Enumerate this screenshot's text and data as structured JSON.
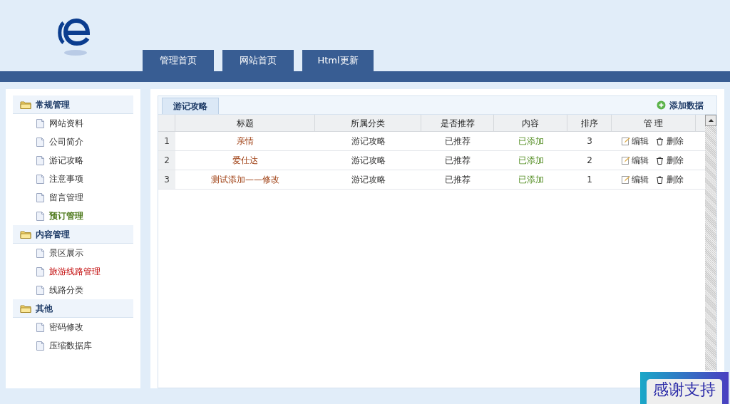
{
  "nav_tabs": [
    {
      "label": "管理首页"
    },
    {
      "label": "网站首页"
    },
    {
      "label": "Html更新"
    }
  ],
  "sidebar": {
    "groups": [
      {
        "title": "常规管理",
        "items": [
          {
            "label": "网站资料",
            "kind": "normal"
          },
          {
            "label": "公司简介",
            "kind": "normal"
          },
          {
            "label": "游记攻略",
            "kind": "normal"
          },
          {
            "label": "注意事项",
            "kind": "normal"
          },
          {
            "label": "留言管理",
            "kind": "normal"
          },
          {
            "label": "预订管理",
            "kind": "current"
          }
        ]
      },
      {
        "title": "内容管理",
        "items": [
          {
            "label": "景区展示",
            "kind": "normal"
          },
          {
            "label": "旅游线路管理",
            "kind": "highlighted"
          },
          {
            "label": "线路分类",
            "kind": "normal"
          }
        ]
      },
      {
        "title": "其他",
        "items": [
          {
            "label": "密码修改",
            "kind": "normal"
          },
          {
            "label": "压缩数据库",
            "kind": "normal"
          }
        ]
      }
    ]
  },
  "panel": {
    "tab": "游记攻略",
    "add_button": "添加数据",
    "table": {
      "columns": [
        "标题",
        "所属分类",
        "是否推荐",
        "内容",
        "排序",
        "管 理"
      ],
      "rows": [
        {
          "index": "1",
          "title": "亲情",
          "category": "游记攻略",
          "recommended": "已推荐",
          "content": "已添加",
          "order": "3",
          "edit": "编辑",
          "delete": "删除"
        },
        {
          "index": "2",
          "title": "爱仕达",
          "category": "游记攻略",
          "recommended": "已推荐",
          "content": "已添加",
          "order": "2",
          "edit": "编辑",
          "delete": "删除"
        },
        {
          "index": "3",
          "title": "测试添加——修改",
          "category": "游记攻略",
          "recommended": "已推荐",
          "content": "已添加",
          "order": "1",
          "edit": "编辑",
          "delete": "删除"
        }
      ]
    }
  },
  "badge": "感谢支持"
}
